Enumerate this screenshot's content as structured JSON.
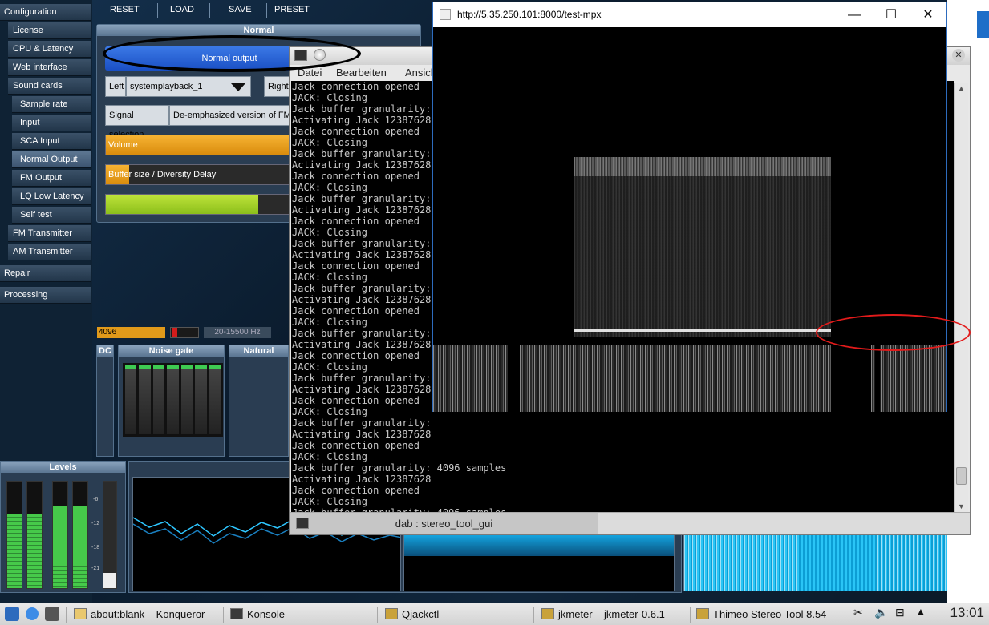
{
  "stereo_tool": {
    "sidebar": {
      "items": [
        {
          "label": "Configuration",
          "top": 0
        },
        {
          "label": "License"
        },
        {
          "label": "CPU & Latency"
        },
        {
          "label": "Web interface"
        },
        {
          "label": "Sound cards"
        },
        {
          "label": "Sample rate"
        },
        {
          "label": "Input"
        },
        {
          "label": "SCA Input"
        },
        {
          "label": "Normal Output"
        },
        {
          "label": "FM Output"
        },
        {
          "label": "LQ Low Latency"
        },
        {
          "label": "Self test"
        },
        {
          "label": "FM Transmitter"
        },
        {
          "label": "AM Transmitter"
        },
        {
          "label": "Repair"
        },
        {
          "label": "Processing"
        }
      ]
    },
    "toolbar": {
      "reset": "RESET",
      "load": "LOAD",
      "save": "SAVE",
      "preset": "PRESET"
    },
    "panel": {
      "title": "Normal",
      "normal_output_button": "Normal output",
      "left_label": "Left",
      "left_value": "systemplayback_1",
      "right_label": "Right",
      "signal_selection_label": "Signal selection",
      "signal_selection_value": "De-emphasized version of FM",
      "volume_label": "Volume",
      "buffer_label": "Buffer size / Diversity Delay"
    },
    "status": {
      "buffer_value": "4096",
      "range": "20-15500 Hz"
    },
    "modules": {
      "dc": "DC",
      "noise_gate": "Noise gate",
      "natural": "Natural"
    },
    "levels_title": "Levels",
    "level_ticks": [
      "-6",
      "-12",
      "-18",
      "-21"
    ]
  },
  "konsole": {
    "menu": [
      "Datei",
      "Bearbeiten",
      "Ansicht"
    ],
    "lines": [
      "Jack connection opened",
      "JACK: Closing",
      "Jack buffer granularity:",
      "Activating Jack 12387628",
      "Jack connection opened",
      "JACK: Closing",
      "Jack buffer granularity:",
      "Activating Jack 12387628",
      "Jack connection opened",
      "JACK: Closing",
      "Jack buffer granularity:",
      "Activating Jack 12387628",
      "Jack connection opened",
      "JACK: Closing",
      "Jack buffer granularity:",
      "Activating Jack 12387628",
      "Jack connection opened",
      "JACK: Closing",
      "Jack buffer granularity:",
      "Activating Jack 12387628",
      "Jack connection opened",
      "JACK: Closing",
      "Jack buffer granularity:",
      "Activating Jack 12387628",
      "Jack connection opened",
      "JACK: Closing",
      "Jack buffer granularity:",
      "Activating Jack 12387628",
      "Jack connection opened",
      "JACK: Closing",
      "Jack buffer granularity:",
      "Activating Jack 12387628",
      "Jack connection opened",
      "JACK: Closing",
      "Jack buffer granularity: 4096 samples",
      "Activating Jack 12387628",
      "Jack connection opened",
      "JACK: Closing",
      "Jack buffer granularity: 4096 samples",
      "Activating Jack 12387628",
      "Jack connection opened"
    ],
    "tab_label": "dab : stereo_tool_gui"
  },
  "browser": {
    "title": "http://5.35.250.101:8000/test-mpx",
    "minimize": "—",
    "maximize": "☐",
    "close": "✕"
  },
  "taskbar": {
    "tasks": [
      {
        "label": "about:blank – Konqueror"
      },
      {
        "label": "Konsole"
      },
      {
        "label": "Qjackctl"
      },
      {
        "label": "jkmeter"
      },
      {
        "label": "jkmeter-0.6.1"
      },
      {
        "label": "Thimeo Stereo Tool 8.54"
      }
    ],
    "clock": "13:01"
  },
  "colors": {
    "annotation_black": "#000000",
    "annotation_red": "#e31b1b",
    "normal_output_blue": "#2a64d8",
    "volume_orange": "#f0a11a",
    "green_bar": "#a7d32a"
  }
}
